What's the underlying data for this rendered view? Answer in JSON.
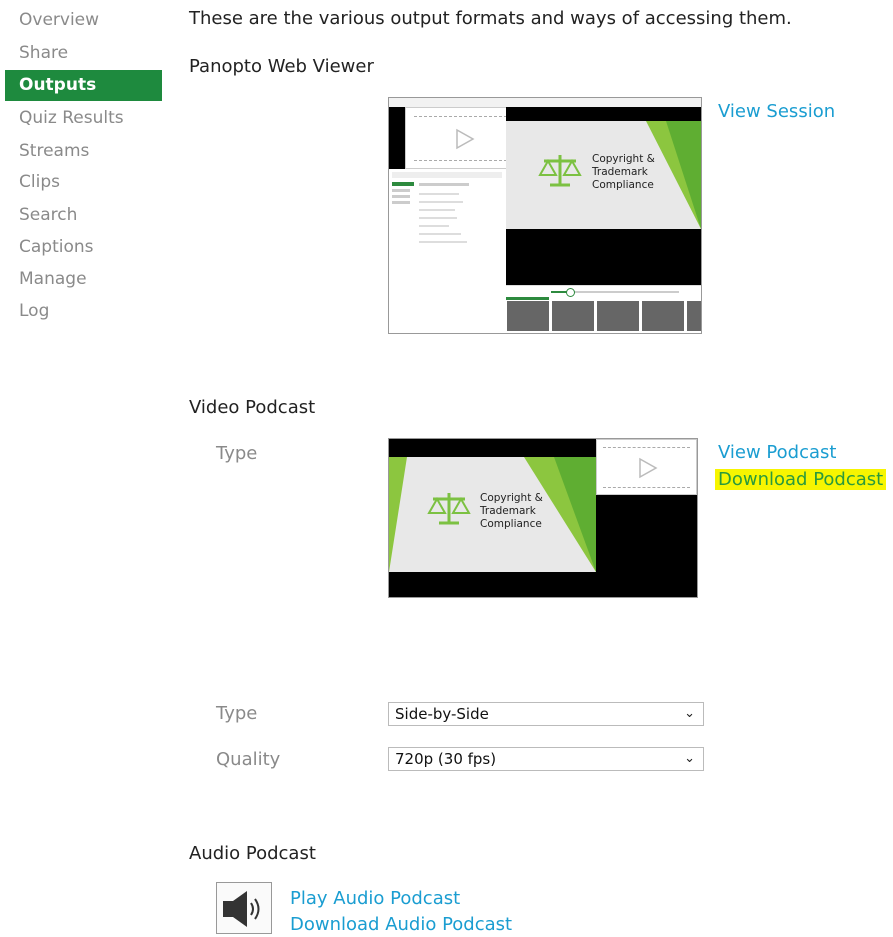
{
  "sidebar": {
    "items": [
      {
        "label": "Overview",
        "active": false
      },
      {
        "label": "Share",
        "active": false
      },
      {
        "label": "Outputs",
        "active": true
      },
      {
        "label": "Quiz Results",
        "active": false
      },
      {
        "label": "Streams",
        "active": false
      },
      {
        "label": "Clips",
        "active": false
      },
      {
        "label": "Search",
        "active": false
      },
      {
        "label": "Captions",
        "active": false
      },
      {
        "label": "Manage",
        "active": false
      },
      {
        "label": "Log",
        "active": false
      }
    ]
  },
  "intro": "These are the various output formats and ways of accessing them.",
  "web_viewer": {
    "title": "Panopto Web Viewer",
    "link": "View Session",
    "slide_title": "Copyright & Trademark Compliance",
    "slide_line1": "Copyright &",
    "slide_line2": "Trademark",
    "slide_line3": "Compliance"
  },
  "video_podcast": {
    "title": "Video Podcast",
    "type_label": "Type",
    "view_link": "View Podcast",
    "download_link": "Download Podcast",
    "slide_line1": "Copyright &",
    "slide_line2": "Trademark",
    "slide_line3": "Compliance"
  },
  "options": {
    "type_label": "Type",
    "type_value": "Side-by-Side",
    "quality_label": "Quality",
    "quality_value": "720p (30 fps)"
  },
  "audio_podcast": {
    "title": "Audio Podcast",
    "play_link": "Play Audio Podcast",
    "download_link": "Download Audio Podcast"
  },
  "colors": {
    "accent_green": "#1e8a3e",
    "link_blue": "#1a9dd1",
    "highlight_yellow": "#f7f500",
    "slide_green": "#8cc63f"
  },
  "icons": {
    "play": "play-icon",
    "scale": "scale-icon",
    "speaker": "speaker-icon",
    "chevron": "chevron-down-icon"
  }
}
